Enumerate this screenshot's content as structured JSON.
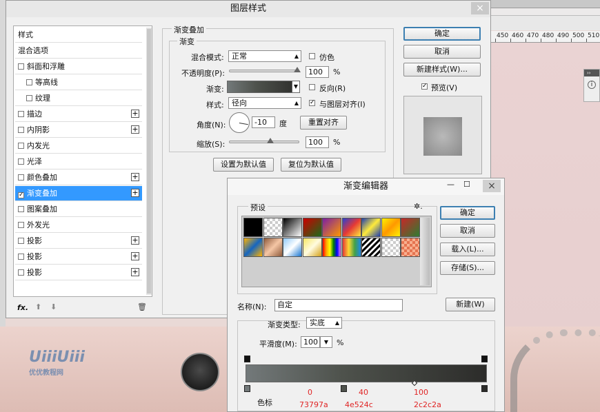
{
  "ruler": [
    "450",
    "460",
    "470",
    "480",
    "490",
    "500",
    "510"
  ],
  "dialog": {
    "title": "图层样式",
    "close": "×",
    "list": [
      {
        "label": "样式",
        "check": false,
        "plus": false,
        "sel": false,
        "indent": false
      },
      {
        "label": "混合选项",
        "check": false,
        "plus": false,
        "sel": false,
        "indent": false
      },
      {
        "label": "斜面和浮雕",
        "check": true,
        "checked": false,
        "plus": false,
        "sel": false,
        "indent": false
      },
      {
        "label": "等高线",
        "check": true,
        "checked": false,
        "plus": false,
        "sel": false,
        "indent": true
      },
      {
        "label": "纹理",
        "check": true,
        "checked": false,
        "plus": false,
        "sel": false,
        "indent": true
      },
      {
        "label": "描边",
        "check": true,
        "checked": false,
        "plus": true,
        "sel": false,
        "indent": false
      },
      {
        "label": "内阴影",
        "check": true,
        "checked": false,
        "plus": true,
        "sel": false,
        "indent": false
      },
      {
        "label": "内发光",
        "check": true,
        "checked": false,
        "plus": false,
        "sel": false,
        "indent": false
      },
      {
        "label": "光泽",
        "check": true,
        "checked": false,
        "plus": false,
        "sel": false,
        "indent": false
      },
      {
        "label": "颜色叠加",
        "check": true,
        "checked": false,
        "plus": true,
        "sel": false,
        "indent": false
      },
      {
        "label": "渐变叠加",
        "check": true,
        "checked": true,
        "plus": true,
        "sel": true,
        "indent": false
      },
      {
        "label": "图案叠加",
        "check": true,
        "checked": false,
        "plus": false,
        "sel": false,
        "indent": false
      },
      {
        "label": "外发光",
        "check": true,
        "checked": false,
        "plus": false,
        "sel": false,
        "indent": false
      },
      {
        "label": "投影",
        "check": true,
        "checked": false,
        "plus": true,
        "sel": false,
        "indent": false
      },
      {
        "label": "投影",
        "check": true,
        "checked": false,
        "plus": true,
        "sel": false,
        "indent": false
      },
      {
        "label": "投影",
        "check": true,
        "checked": false,
        "plus": true,
        "sel": false,
        "indent": false
      }
    ],
    "fx": "fx.",
    "section_title": "渐变叠加",
    "sub_title": "渐变",
    "blend_label": "混合模式:",
    "blend_value": "正常",
    "dither_label": "仿色",
    "opacity_label": "不透明度(P):",
    "opacity_value": "100",
    "pct": "%",
    "gradient_label": "渐变:",
    "reverse_label": "反向(R)",
    "style_label": "样式:",
    "style_value": "径向",
    "align_label": "与图层对齐(I)",
    "angle_label": "角度(N):",
    "angle_value": "-10",
    "degree": "度",
    "reset_align": "重置对齐",
    "scale_label": "缩放(S):",
    "scale_value": "100",
    "set_default": "设置为默认值",
    "reset_default": "复位为默认值",
    "ok": "确定",
    "cancel": "取消",
    "new_style": "新建样式(W)...",
    "preview": "预览(V)"
  },
  "editor": {
    "title": "渐变编辑器",
    "minimize": "—",
    "maximize": "☐",
    "close": "×",
    "presets_label": "预设",
    "gear": "✲.",
    "ok": "确定",
    "cancel": "取消",
    "load": "载入(L)...",
    "save": "存储(S)...",
    "name_label": "名称(N):",
    "name_value": "自定",
    "new": "新建(W)",
    "type_label": "渐变类型:",
    "type_value": "实底",
    "smooth_label": "平滑度(M):",
    "smooth_value": "100",
    "pct": "%",
    "stops_label": "色标",
    "annotations": [
      {
        "pos": "0",
        "color": "73797a"
      },
      {
        "pos": "40",
        "color": "4e524c"
      },
      {
        "pos": "100",
        "color": "2c2c2a"
      }
    ],
    "gradient_colors": [
      "#73797a",
      "#4e524c",
      "#2c2c2a"
    ]
  },
  "background": {
    "watermark": "UiiiUiii",
    "watermark_sub": "优优教程网"
  }
}
